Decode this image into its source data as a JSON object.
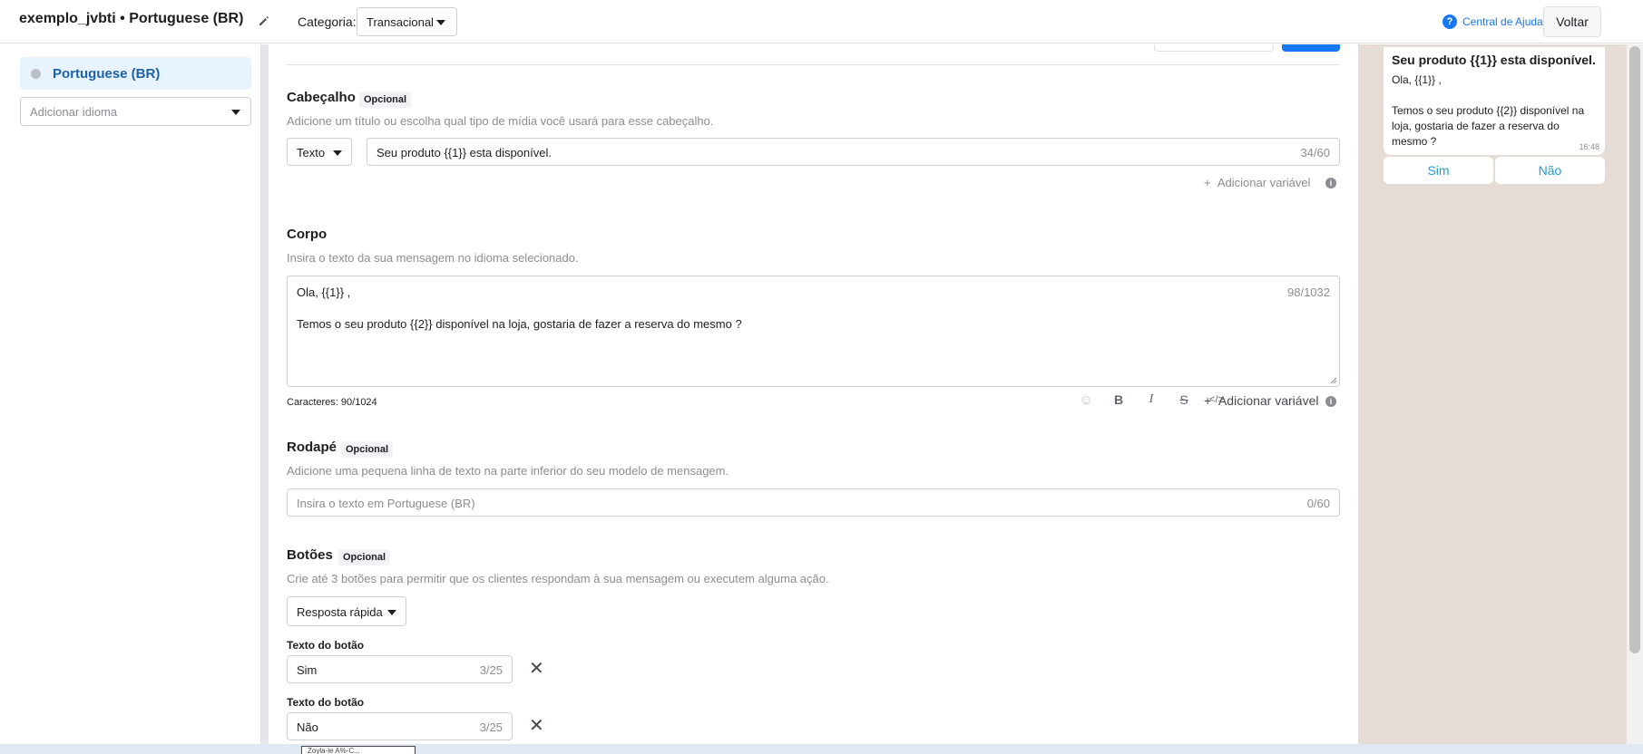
{
  "header": {
    "template_name": "exemplo_jvbti • Portuguese (BR)",
    "category_label": "Categoria:",
    "category_value": "Transacional",
    "help_label": "Central de Ajuda",
    "back_label": "Voltar"
  },
  "sidebar": {
    "languages": [
      {
        "label": "Portuguese (BR)"
      }
    ],
    "add_language_placeholder": "Adicionar idioma"
  },
  "cabecalho": {
    "title": "Cabeçalho",
    "badge": "Opcional",
    "description": "Adicione um título ou escolha qual tipo de mídia você usará para esse cabeçalho.",
    "type_value": "Texto",
    "text_value": "Seu produto {{1}} esta disponível.",
    "counter": "34/60",
    "add_variable": "Adicionar variável"
  },
  "corpo": {
    "title": "Corpo",
    "description": "Insira o texto da sua mensagem no idioma selecionado.",
    "line1": "Ola, {{1}} ,",
    "line2": "Temos o seu produto {{2}} disponível na loja, gostaria de fazer a reserva do mesmo ?",
    "counter": "98/1032",
    "char_count": "Caracteres: 90/1024",
    "add_variable": "Adicionar variável",
    "toolbar": [
      {
        "name": "emoji-icon",
        "glyph": "☺"
      },
      {
        "name": "bold-icon",
        "glyph": "B"
      },
      {
        "name": "italic-icon",
        "glyph": "I"
      },
      {
        "name": "strikethrough-icon",
        "glyph": "S"
      },
      {
        "name": "code-icon",
        "glyph": "</>"
      }
    ]
  },
  "rodape": {
    "title": "Rodapé",
    "badge": "Opcional",
    "description": "Adicione uma pequena linha de texto na parte inferior do seu modelo de mensagem.",
    "placeholder": "Insira o texto em Portuguese (BR)",
    "counter": "0/60"
  },
  "botoes": {
    "title": "Botões",
    "badge": "Opcional",
    "description": "Crie até 3 botões para permitir que os clientes respondam à sua mensagem ou executem alguma ação.",
    "type_value": "Resposta rápida",
    "buttons": [
      {
        "label": "Texto do botão",
        "value": "Sim",
        "counter": "3/25"
      },
      {
        "label": "Texto do botão",
        "value": "Não",
        "counter": "3/25"
      }
    ]
  },
  "preview": {
    "header": "Seu produto {{1}} esta disponível.",
    "body": "Ola, {{1}} ,\n\nTemos o seu produto {{2}} disponível na loja, gostaria de fazer a reserva do mesmo ?",
    "time": "16:48",
    "quick_replies": [
      "Sim",
      "Não"
    ]
  },
  "tooltip_fragment": "Zoyla-le A%-C..."
}
